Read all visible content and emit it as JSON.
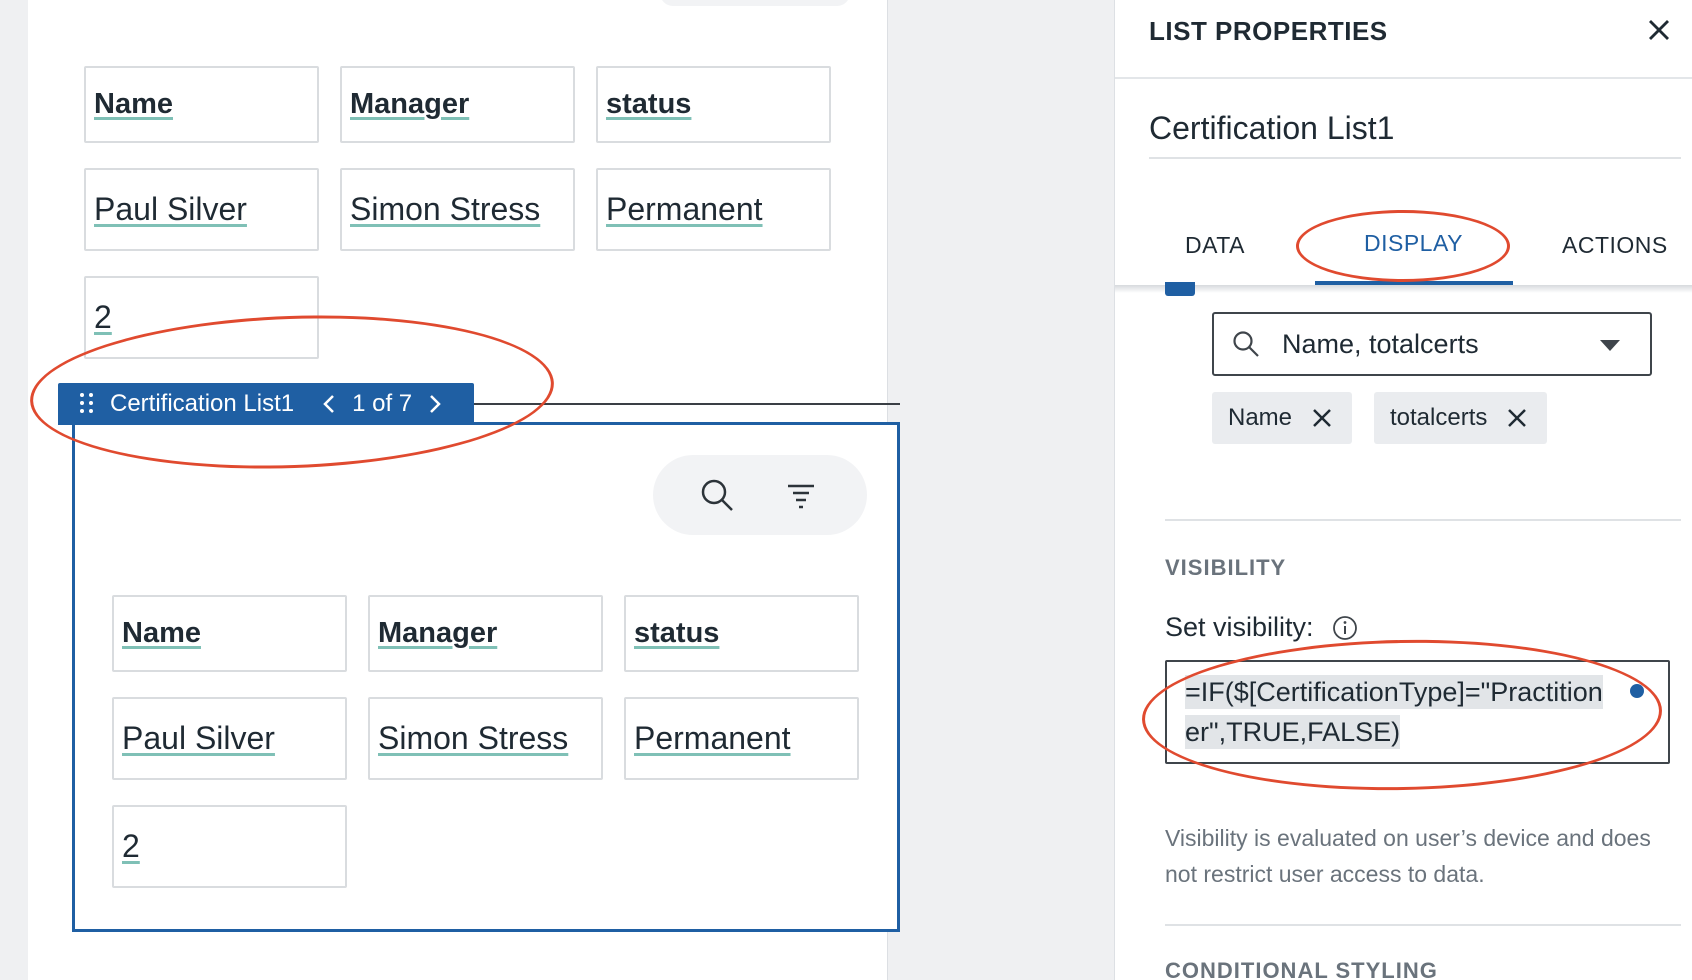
{
  "canvas": {
    "list_above": {
      "headers": [
        "Name",
        "Manager",
        "status"
      ],
      "row": [
        "Paul Silver",
        "Simon Stress",
        "Permanent"
      ],
      "count": "2"
    },
    "list_tag": {
      "label": "Certification List1",
      "pager": "1 of 7"
    },
    "list_selected": {
      "headers": [
        "Name",
        "Manager",
        "status"
      ],
      "row": [
        "Paul Silver",
        "Simon Stress",
        "Permanent"
      ],
      "count": "2"
    }
  },
  "panel": {
    "title": "LIST PROPERTIES",
    "list_name": "Certification List1",
    "tabs": [
      "DATA",
      "DISPLAY",
      "ACTIONS"
    ],
    "active_tab": "DISPLAY",
    "sort": {
      "value": "Name, totalcerts",
      "chips": [
        "Name",
        "totalcerts"
      ]
    },
    "visibility": {
      "section_title": "VISIBILITY",
      "label": "Set visibility:",
      "expression": "=IF($[CertificationType]=\"Practitioner\",TRUE,FALSE)",
      "note": "Visibility is evaluated on user’s device and does not restrict user access to data."
    },
    "conditional_styling_title": "CONDITIONAL STYLING"
  },
  "colors": {
    "accent": "#1f5fa3",
    "annotation": "#e04a2f",
    "underline": "#7fc0b6"
  }
}
